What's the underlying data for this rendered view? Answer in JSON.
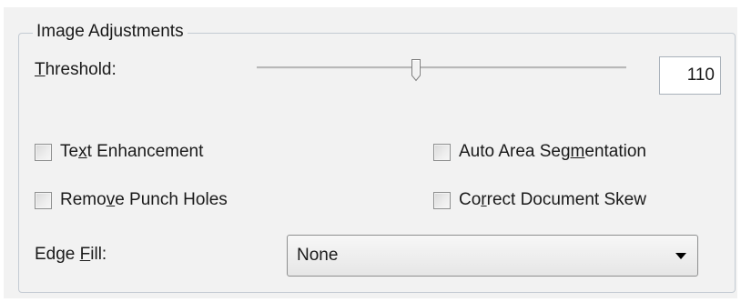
{
  "group": {
    "title": "Image Adjustments"
  },
  "threshold": {
    "label_mnemonic": "T",
    "label_rest": "hreshold:",
    "value": "110",
    "slider_level_fraction": 0.43
  },
  "checkboxes": {
    "text_enhancement": {
      "pre": "Te",
      "mnemonic": "x",
      "post": "t Enhancement",
      "checked": false
    },
    "remove_punch_holes": {
      "pre": "Remo",
      "mnemonic": "v",
      "post": "e Punch Holes",
      "checked": false
    },
    "auto_area_segmentation": {
      "pre": "Auto Area Seg",
      "mnemonic": "m",
      "post": "entation",
      "checked": false
    },
    "correct_document_skew": {
      "pre": "Co",
      "mnemonic": "r",
      "post": "rect Document Skew",
      "checked": false
    }
  },
  "edge_fill": {
    "label_pre": "Edge ",
    "label_mnemonic": "F",
    "label_post": "ill:",
    "selected": "None"
  },
  "icons": {
    "dropdown_arrow": "triangle-down-icon",
    "slider_thumb": "slider-thumb-icon"
  },
  "colors": {
    "panel_background": "#f2f2f2",
    "group_border": "#c4cbd3",
    "checkbox_border": "#8e8f8f"
  }
}
